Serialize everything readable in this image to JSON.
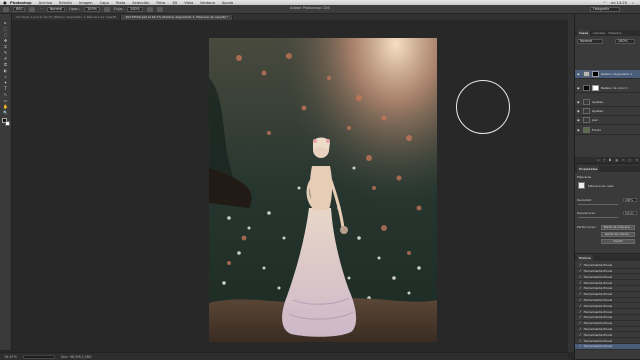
{
  "menubar": {
    "apple": "",
    "items": [
      "Photoshop",
      "Archivo",
      "Edición",
      "Imagen",
      "Capa",
      "Texto",
      "Selección",
      "Filtro",
      "3D",
      "Vista",
      "Ventana",
      "Ayuda"
    ],
    "right_time": "mi 14:25"
  },
  "app_title": "Adobe Photoshop CS6",
  "options": {
    "size_value": "800",
    "mode_value": "Normal",
    "opacity_label": "Opac.:",
    "opacity_value": "100%",
    "flow_label": "Flujo:",
    "flow_value": "100%"
  },
  "workspace": "Fotografía",
  "doc_tabs": [
    {
      "label": "Sin título-1.psd al 16,7% (Motivo degradado 1, Máscara de capa/8)",
      "active": false
    },
    {
      "label": "20170530.psd al 16,7% (Relleno degradado 1, Máscara de capa/8) *",
      "active": true
    }
  ],
  "tools": [
    "▸",
    "⬚",
    "◌",
    "✥",
    "⌗",
    "✎",
    "✐",
    "⎚",
    "◐",
    "♨",
    "✦",
    "T",
    "↖",
    "▭",
    "✋",
    "🔍"
  ],
  "status": {
    "zoom": "16,67%",
    "doc": "Doc: 98,5M/1,08G"
  },
  "layers_panel": {
    "tabs": [
      "Capas",
      "Canales",
      "Trazados"
    ],
    "blend": "Normal",
    "opacity": "100%",
    "rows": [
      {
        "label": "Relleno degradado 1",
        "selected": true,
        "thumb_color": "#b8b8b8"
      },
      {
        "label": "Relleno de color 1",
        "selected": false,
        "thumb_color": "#0a0a0a"
      },
      {
        "label": "Ajustes",
        "selected": false,
        "thumb_color": "#3a3a3a"
      },
      {
        "label": "Ajustes",
        "selected": false,
        "thumb_color": "#3a3a3a"
      },
      {
        "label": "piel",
        "selected": false,
        "thumb_color": "#3a3a3a"
      },
      {
        "label": "Fondo",
        "selected": false,
        "thumb_color": "#5b6b4a"
      }
    ]
  },
  "properties_panel": {
    "title": "Propiedades",
    "subtitle": "Máscaras",
    "mask_label": "Máscara de capa",
    "density_label": "Densidad:",
    "density_value": "100%",
    "feather_label": "Desvanecer:",
    "feather_value": "0,0 px",
    "refine_label": "Perfeccionar:",
    "buttons": [
      "Borde de máscara...",
      "Gama de colores...",
      "Invertir"
    ]
  },
  "history_panel": {
    "title": "Historia",
    "items": [
      "Herramienta Pincel",
      "Herramienta Pincel",
      "Herramienta Pincel",
      "Herramienta Pincel",
      "Herramienta Pincel",
      "Herramienta Pincel",
      "Herramienta Pincel",
      "Herramienta Pincel",
      "Herramienta Pincel",
      "Herramienta Pincel",
      "Herramienta Pincel",
      "Herramienta Pincel",
      "Herramienta Pincel",
      "Herramienta Pincel",
      "Herramienta Pincel"
    ],
    "selected_index": 14
  }
}
